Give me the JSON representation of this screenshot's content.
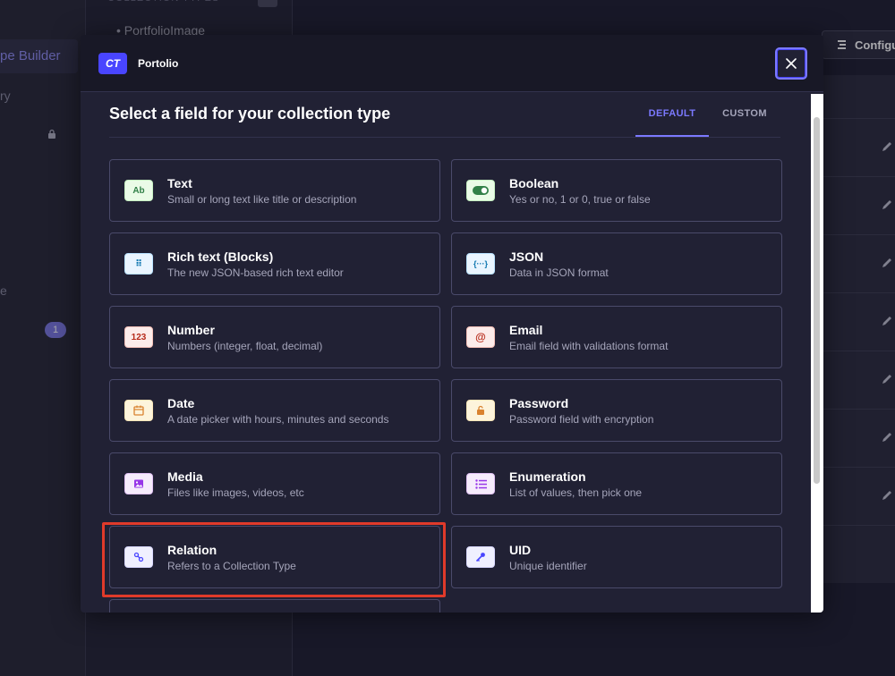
{
  "background": {
    "sidebar_active_label": "pe Builder",
    "sidebar_text_1": "ry",
    "sidebar_text_2": "e",
    "notification_count": "1",
    "collection_item": "PortfolioImage",
    "configure_label": "Configu"
  },
  "modal": {
    "badge": "CT",
    "name": "Portolio",
    "heading": "Select a field for your collection type",
    "tabs": [
      {
        "label": "DEFAULT"
      },
      {
        "label": "CUSTOM"
      }
    ],
    "fields": [
      {
        "title": "Text",
        "desc": "Small or long text like title or description",
        "icon": "Ab",
        "icon_name": "text-icon"
      },
      {
        "title": "Boolean",
        "desc": "Yes or no, 1 or 0, true or false",
        "icon": "",
        "icon_name": "toggle-icon"
      },
      {
        "title": "Rich text (Blocks)",
        "desc": "The new JSON-based rich text editor",
        "icon": "⠿",
        "icon_name": "blocks-icon"
      },
      {
        "title": "JSON",
        "desc": "Data in JSON format",
        "icon": "{···}",
        "icon_name": "json-icon"
      },
      {
        "title": "Number",
        "desc": "Numbers (integer, float, decimal)",
        "icon": "123",
        "icon_name": "number-icon"
      },
      {
        "title": "Email",
        "desc": "Email field with validations format",
        "icon": "@",
        "icon_name": "email-icon"
      },
      {
        "title": "Date",
        "desc": "A date picker with hours, minutes and seconds",
        "icon": "",
        "icon_name": "calendar-icon"
      },
      {
        "title": "Password",
        "desc": "Password field with encryption",
        "icon": "",
        "icon_name": "lock-icon"
      },
      {
        "title": "Media",
        "desc": "Files like images, videos, etc",
        "icon": "",
        "icon_name": "image-icon"
      },
      {
        "title": "Enumeration",
        "desc": "List of values, then pick one",
        "icon": "",
        "icon_name": "list-icon"
      },
      {
        "title": "Relation",
        "desc": "Refers to a Collection Type",
        "icon": "",
        "icon_name": "link-icon"
      },
      {
        "title": "UID",
        "desc": "Unique identifier",
        "icon": "",
        "icon_name": "key-icon"
      }
    ]
  },
  "colors": {
    "accent": "#7b79ff",
    "highlight": "#e03a2a"
  }
}
